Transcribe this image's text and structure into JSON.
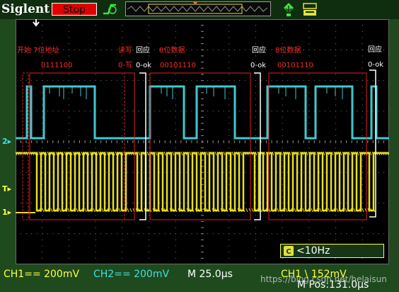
{
  "header": {
    "brand": "Siglent",
    "run_state": "Stop"
  },
  "annotations": {
    "start_7bit_addr": "开始 7位地址",
    "addr_bits": "0111100",
    "rw_label": "读写",
    "rw_value": "0-写",
    "ack1_label": "回应",
    "ack1_value": "0-ok",
    "data1_label": "8位数据",
    "data1_bits": "00101110",
    "ack2_label": "回应",
    "ack2_value": "0-ok",
    "data2_label": "8位数据",
    "data2_bits": "00101110",
    "ack3_label": "回应",
    "ack3_value": "0-ok"
  },
  "channel_markers": {
    "ch2_marker": "2",
    "trigger_marker": "T",
    "ch1_marker": "1"
  },
  "measurements": {
    "freq": "<10Hz"
  },
  "status": {
    "ch1_scale": "CH1== 200mV",
    "ch2_scale": "CH2== 200mV",
    "timebase": "M 25.0μs",
    "trigger": "CH1 \\ 152mV",
    "position": "M Pos:131.0μs"
  },
  "watermark": "https://blog.csdn.net/helaisun",
  "colors": {
    "scl_trace": "#40c8d0",
    "sda_trace": "#e8e020",
    "annotation_box": "#e02020",
    "annotation_text": "#ff2a2a",
    "stop_button": "#e00000",
    "status_ch1": "#ffff40",
    "status_ch2": "#40e0e0"
  }
}
